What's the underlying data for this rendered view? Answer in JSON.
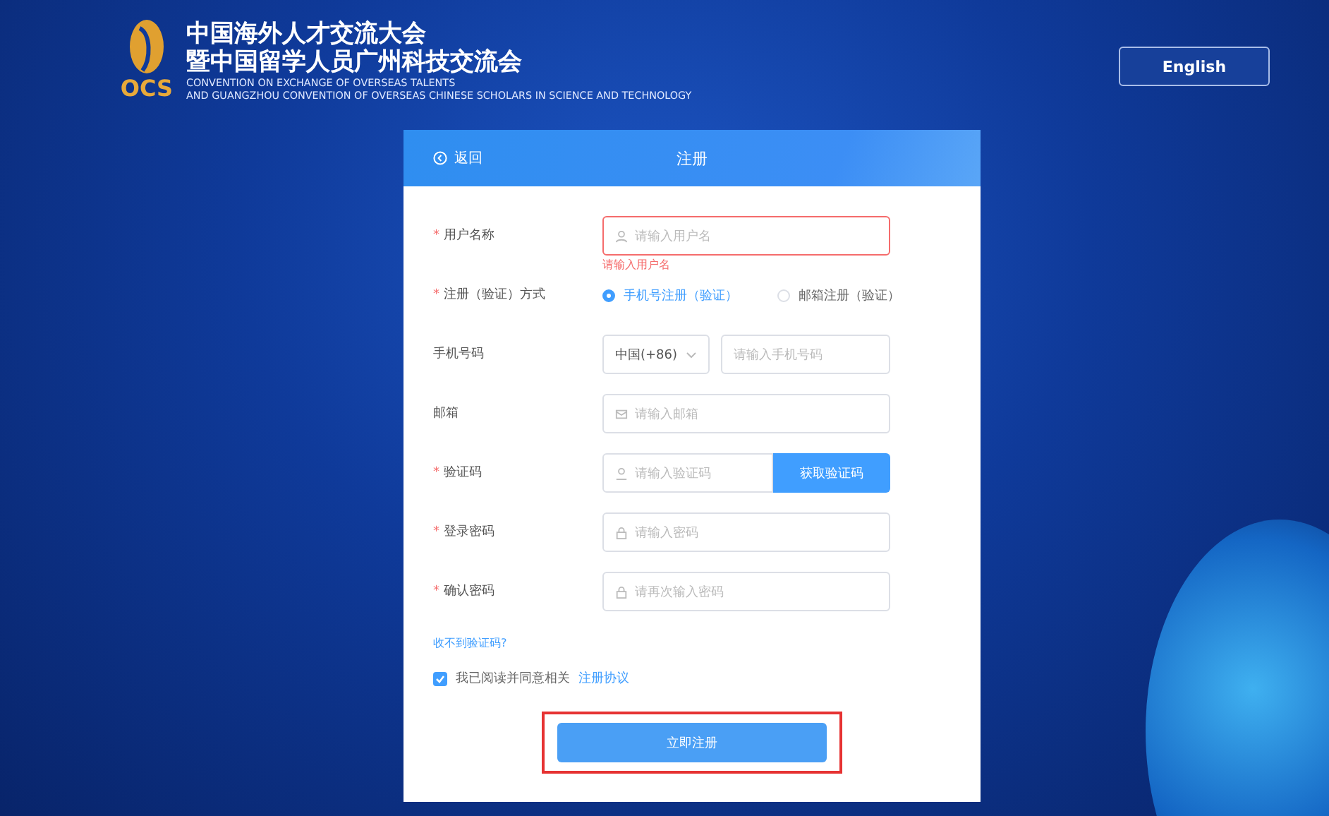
{
  "header": {
    "logo_text": "OCS",
    "title_lines": [
      "中国海外人才交流大会",
      "暨中国留学人员广州科技交流会"
    ],
    "subtitle_lines": [
      "CONVENTION ON EXCHANGE OF OVERSEAS TALENTS",
      "AND GUANGZHOU CONVENTION OF OVERSEAS CHINESE SCHOLARS IN SCIENCE AND TECHNOLOGY"
    ],
    "language_button": "English"
  },
  "card": {
    "back": "返回",
    "title": "注册"
  },
  "fields": [
    {
      "kind": "user",
      "mark": "*",
      "label": "用户名称",
      "placeholder": "请输入用户名",
      "error": "请输入用户名"
    },
    {
      "kind": "radio",
      "mark": "*",
      "label": "注册（验证）方式",
      "options": [
        {
          "label": "手机号注册（验证）",
          "selected": true
        },
        {
          "label": "邮箱注册（验证）",
          "selected": false
        }
      ]
    },
    {
      "kind": "phone",
      "label": "手机号码",
      "country": "中国(+86)",
      "placeholder": "请输入手机号码"
    },
    {
      "kind": "mail",
      "label": "邮箱",
      "placeholder": "请输入邮箱"
    },
    {
      "kind": "code",
      "mark": "*",
      "label": "验证码",
      "placeholder": "请输入验证码",
      "button": "获取验证码"
    },
    {
      "kind": "password",
      "mark": "*",
      "label": "登录密码",
      "placeholder": "请输入密码"
    },
    {
      "kind": "password",
      "mark": "*",
      "label": "确认密码",
      "placeholder": "请再次输入密码"
    }
  ],
  "help_link": "收不到验证码?",
  "agreement": {
    "checked": true,
    "text": "我已阅读并同意相关",
    "link": "注册协议"
  },
  "submit": {
    "label": "立即注册",
    "highlighted": true
  }
}
